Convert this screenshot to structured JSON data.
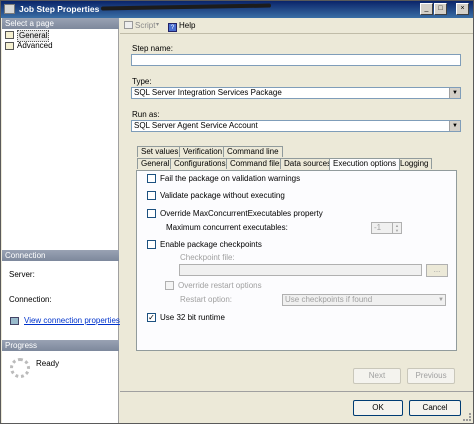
{
  "window": {
    "title": "Job Step Properties",
    "controls": {
      "minimize": "_",
      "maximize": "□",
      "close": "×"
    }
  },
  "left_pane": {
    "select_page_header": "Select a page",
    "pages": [
      {
        "label": "General",
        "selected": true
      },
      {
        "label": "Advanced",
        "selected": false
      }
    ],
    "connection_header": "Connection",
    "server_label": "Server:",
    "connection_label": "Connection:",
    "view_connection_link": "View connection properties",
    "progress_header": "Progress",
    "progress_status": "Ready"
  },
  "toolbar": {
    "script_label": "Script",
    "script_arrow": "▾",
    "help_label": "Help",
    "help_icon": "?"
  },
  "form": {
    "step_name_label": "Step name:",
    "step_name_value": "",
    "type_label": "Type:",
    "type_value": "SQL Server Integration Services Package",
    "run_as_label": "Run as:",
    "run_as_value": "SQL Server Agent Service Account"
  },
  "tabs": {
    "top_row": [
      "Set values",
      "Verification",
      "Command line"
    ],
    "bottom_row": [
      "General",
      "Configurations",
      "Command files",
      "Data sources",
      "Execution options",
      "Logging"
    ],
    "active": "Execution options"
  },
  "execution_options": {
    "fail_on_warnings": {
      "label": "Fail the package on validation warnings",
      "checked": false
    },
    "validate_without_executing": {
      "label": "Validate package without executing",
      "checked": false
    },
    "override_max_concurrent": {
      "label": "Override MaxConcurrentExecutables property",
      "checked": false
    },
    "max_concurrent_label": "Maximum concurrent executables:",
    "max_concurrent_value": "-1",
    "enable_checkpoints": {
      "label": "Enable package checkpoints",
      "checked": false
    },
    "checkpoint_file_label": "Checkpoint file:",
    "checkpoint_file_value": "",
    "browse_label": "...",
    "override_restart": {
      "label": "Override restart options",
      "checked": false
    },
    "restart_option_label": "Restart option:",
    "restart_option_value": "Use checkpoints if found",
    "use_32bit": {
      "label": "Use 32 bit runtime",
      "checked": true,
      "mark": "✓"
    }
  },
  "buttons": {
    "next": "Next",
    "previous": "Previous",
    "ok": "OK",
    "cancel": "Cancel"
  },
  "colors": {
    "titlebar_dark": "#0a246a",
    "titlebar_light": "#3a6ea5",
    "dialog_bg": "#ece9d8",
    "section_header": "#7d889c",
    "link": "#0033cc"
  },
  "icons": {
    "general_page": "page-icon",
    "advanced_page": "page-icon",
    "script": "script-icon",
    "help": "help-icon",
    "connection": "connection-icon",
    "progress": "spinner-icon"
  }
}
